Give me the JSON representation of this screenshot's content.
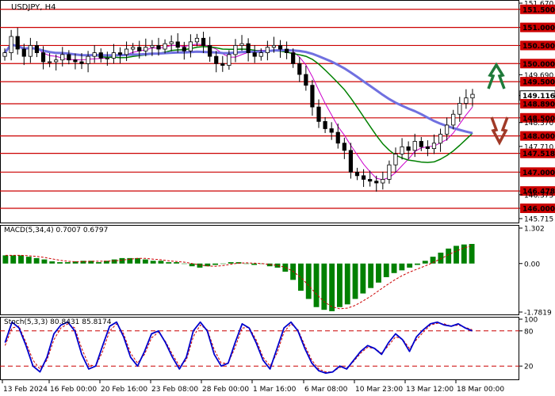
{
  "chart_data": [
    {
      "type": "candlestick",
      "title": "USDJPY, H4",
      "ylim": [
        145.715,
        151.67
      ],
      "x_ticks": [
        "13 Feb 2024",
        "16 Feb 00:00",
        "20 Feb 16:00",
        "23 Feb 08:00",
        "28 Feb 00:00",
        "1 Mar 16:00",
        "6 Mar 08:00",
        "10 Mar 23:00",
        "13 Mar 12:00",
        "18 Mar 00:00"
      ],
      "y_ticks": [
        "151.670",
        "151.500",
        "151.000",
        "150.500",
        "150.000",
        "149.690",
        "149.500",
        "149.116",
        "148.890",
        "148.500",
        "148.370",
        "148.000",
        "147.710",
        "147.518",
        "147.000",
        "146.478",
        "146.375",
        "146.000",
        "145.715"
      ],
      "levels": [
        151.5,
        151.0,
        150.5,
        150.0,
        149.5,
        148.89,
        148.5,
        148.0,
        147.518,
        147.0,
        146.478,
        146.0
      ],
      "current_price": "149.116",
      "close_series": [
        150.3,
        150.75,
        150.4,
        150.2,
        150.5,
        150.3,
        150.05,
        150.05,
        150.1,
        150.25,
        150.1,
        150.05,
        150.0,
        150.2,
        150.3,
        150.15,
        150.15,
        150.3,
        150.25,
        150.4,
        150.45,
        150.35,
        150.45,
        150.5,
        150.4,
        150.55,
        150.6,
        150.45,
        150.35,
        150.6,
        150.7,
        150.5,
        150.2,
        150.0,
        149.95,
        150.25,
        150.5,
        150.55,
        150.3,
        150.2,
        150.3,
        150.45,
        150.5,
        150.4,
        150.3,
        150.0,
        149.7,
        149.4,
        148.8,
        148.4,
        148.2,
        148.1,
        147.8,
        147.6,
        147.0,
        146.9,
        146.8,
        146.75,
        146.7,
        146.8,
        147.2,
        147.5,
        147.7,
        147.6,
        147.85,
        147.7,
        147.65,
        147.8,
        148.05,
        148.3,
        148.6,
        148.9,
        149.05,
        149.15
      ],
      "moving_averages": [
        {
          "color": "#cc00cc"
        },
        {
          "color": "#008000"
        },
        {
          "color": "#7070e0"
        }
      ],
      "trend_arrows": {
        "up_color": "#1f7a3a",
        "down_color": "#a03a28"
      }
    },
    {
      "type": "bar",
      "title": "MACD(5,34,4) 0.7007 0.6797",
      "y_ticks": [
        "1.302",
        "0.00",
        "-1.7819"
      ],
      "ylim": [
        -1.7819,
        1.302
      ],
      "histogram": [
        0.3,
        0.3,
        0.3,
        0.25,
        0.2,
        0.15,
        0.08,
        0.05,
        0.05,
        0.08,
        0.1,
        0.1,
        0.05,
        0.1,
        0.15,
        0.2,
        0.2,
        0.2,
        0.15,
        0.1,
        0.1,
        0.05,
        0.05,
        0.0,
        -0.1,
        -0.15,
        -0.1,
        -0.05,
        0.0,
        0.05,
        0.05,
        0.0,
        -0.05,
        0.0,
        -0.1,
        -0.15,
        -0.3,
        -0.6,
        -1.0,
        -1.3,
        -1.6,
        -1.7,
        -1.75,
        -1.6,
        -1.5,
        -1.3,
        -1.1,
        -0.9,
        -0.7,
        -0.5,
        -0.35,
        -0.25,
        -0.15,
        -0.05,
        0.1,
        0.25,
        0.4,
        0.55,
        0.65,
        0.7,
        0.72
      ],
      "colors": {
        "bars": "#008000",
        "signal": "#cc0000"
      }
    },
    {
      "type": "line",
      "title": "Stoch(5,3,3) 80.8431 85.8174",
      "y_ticks": [
        "100",
        "80",
        "20",
        "0"
      ],
      "ylim": [
        0,
        100
      ],
      "levels": [
        80,
        20
      ],
      "main": [
        60,
        95,
        85,
        55,
        20,
        10,
        35,
        75,
        90,
        95,
        80,
        40,
        15,
        20,
        55,
        88,
        95,
        70,
        35,
        20,
        45,
        75,
        80,
        60,
        35,
        15,
        35,
        80,
        95,
        80,
        40,
        20,
        25,
        60,
        92,
        85,
        60,
        30,
        15,
        50,
        85,
        95,
        80,
        50,
        25,
        12,
        8,
        10,
        20,
        15,
        30,
        45,
        55,
        50,
        40,
        60,
        75,
        65,
        45,
        70,
        82,
        92,
        95,
        90,
        88,
        92,
        85,
        80
      ],
      "signal": [
        55,
        85,
        88,
        60,
        30,
        15,
        30,
        65,
        85,
        92,
        85,
        50,
        22,
        20,
        45,
        80,
        92,
        75,
        42,
        25,
        40,
        68,
        78,
        62,
        40,
        20,
        30,
        70,
        90,
        82,
        48,
        25,
        25,
        52,
        85,
        86,
        65,
        35,
        20,
        42,
        78,
        92,
        82,
        55,
        30,
        15,
        10,
        10,
        18,
        17,
        28,
        42,
        52,
        50,
        42,
        55,
        70,
        66,
        50,
        65,
        78,
        90,
        93,
        92,
        88,
        90,
        86,
        82
      ],
      "colors": {
        "main": "#0000cc",
        "signal": "#cc0000",
        "levels": "#cc0000"
      }
    }
  ]
}
